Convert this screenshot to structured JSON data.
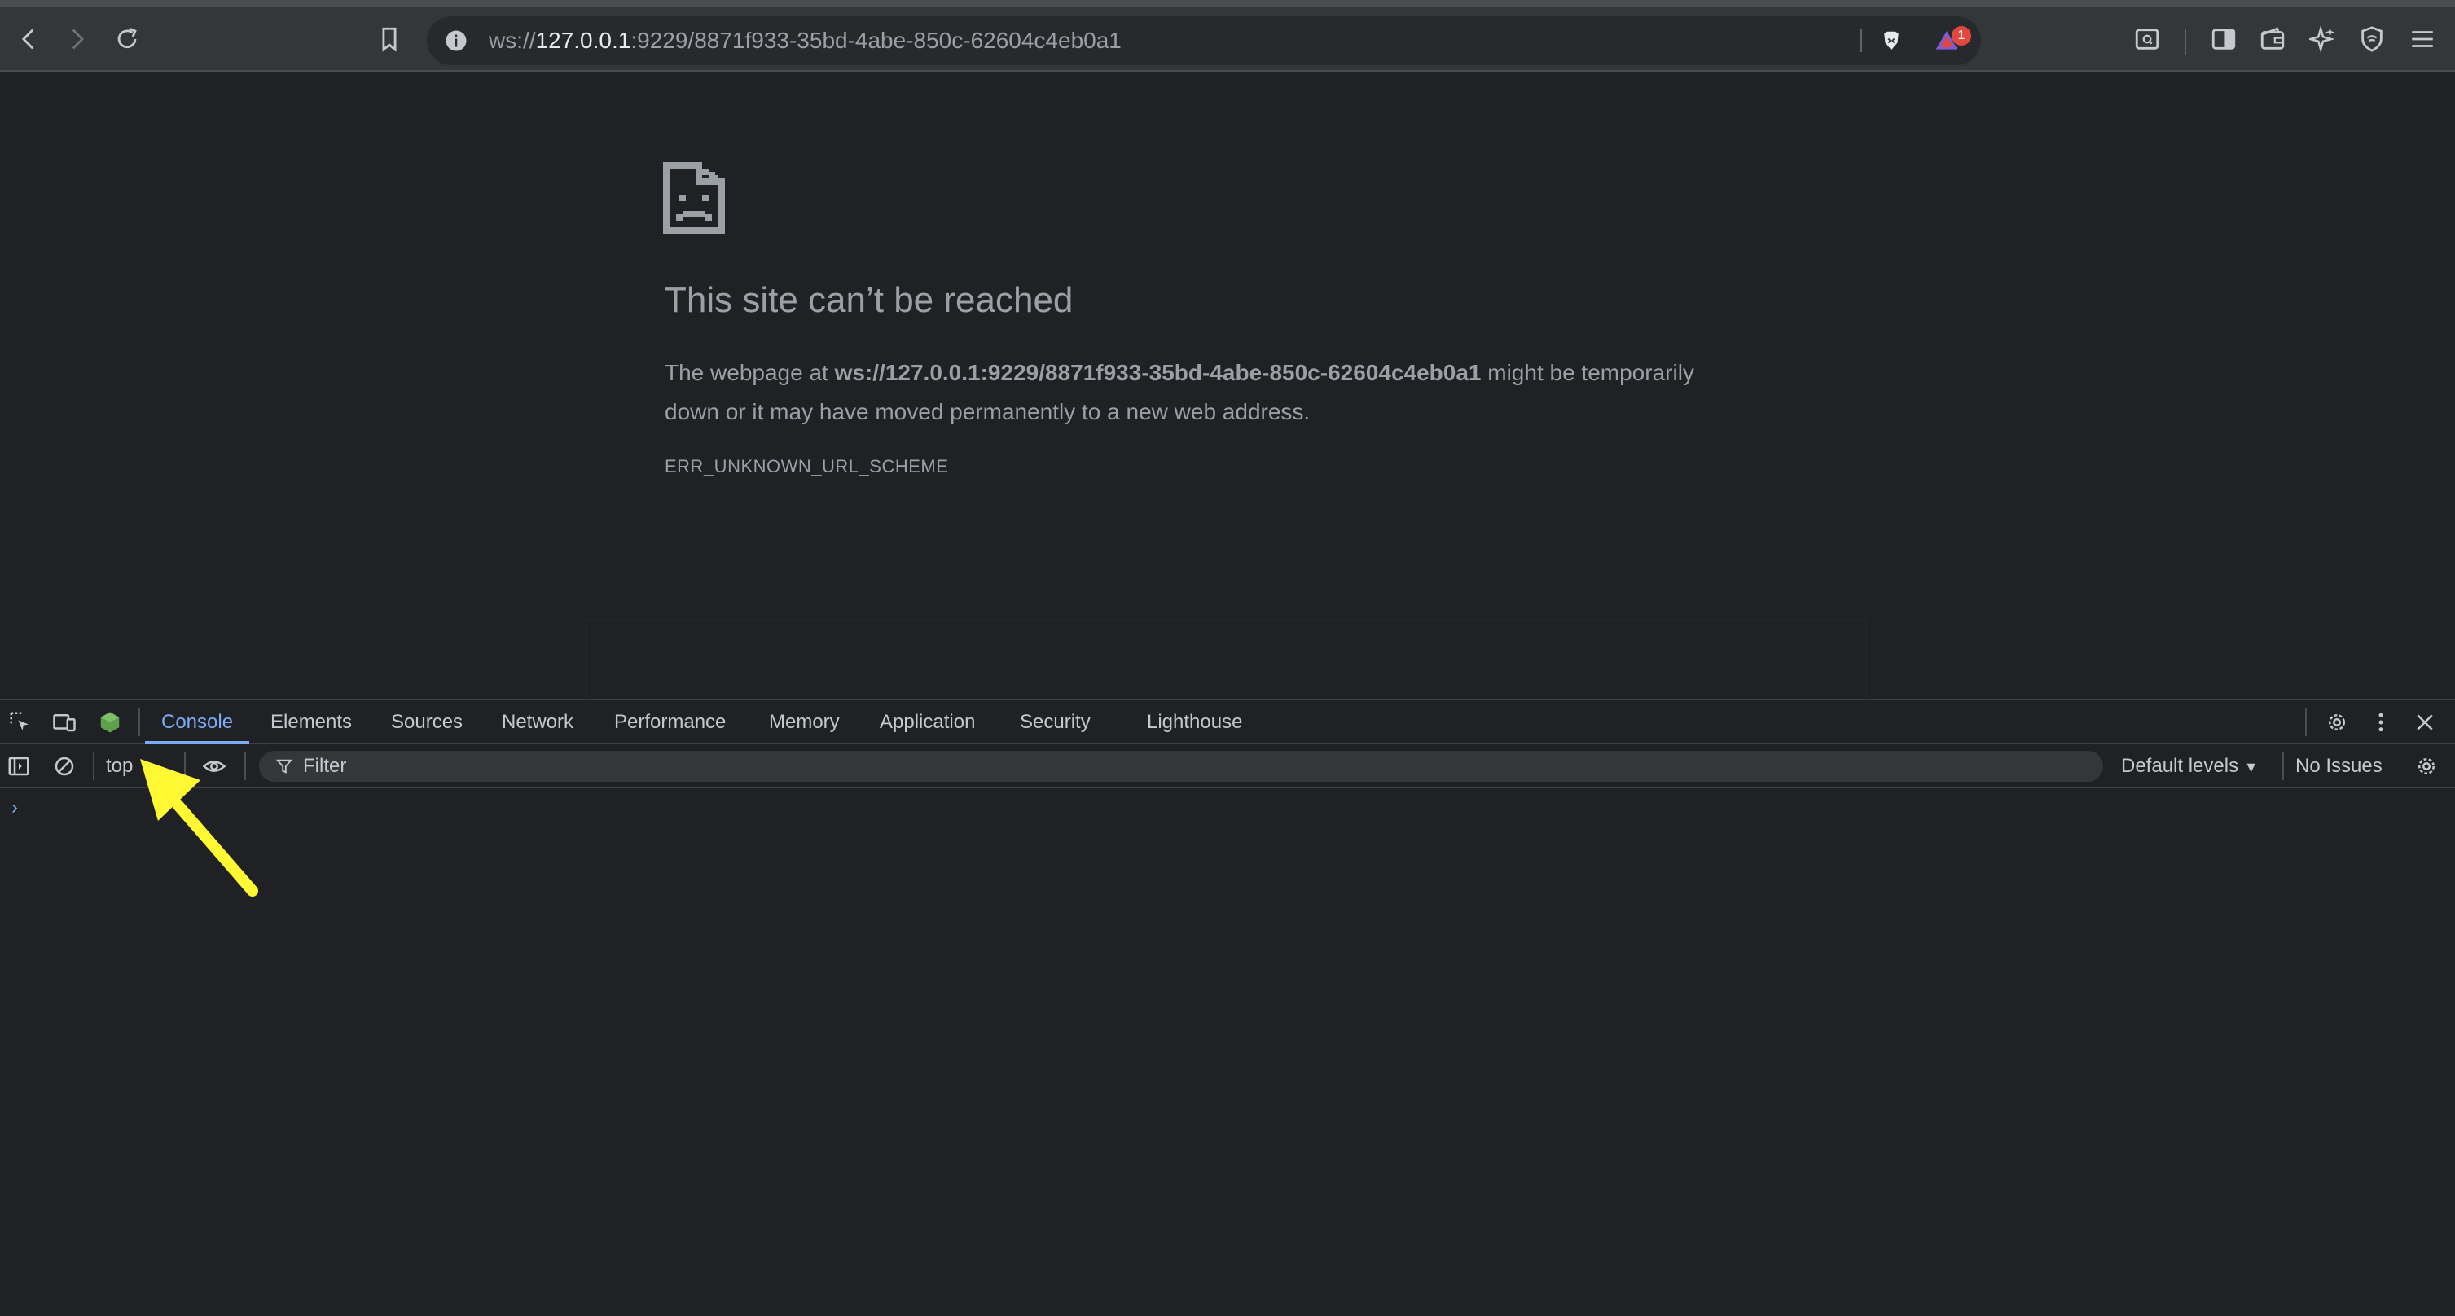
{
  "browser": {
    "url_prefix": "ws://",
    "url_host": "127.0.0.1",
    "url_rest": ":9229/8871f933-35bd-4abe-850c-62604c4eb0a1",
    "notification_count": "1",
    "colors": {
      "toolbar": "#35363a",
      "omnibox": "#28292c",
      "badge": "#e3483f"
    }
  },
  "error_page": {
    "title": "This site can’t be reached",
    "message_before": "The webpage at ",
    "message_url": "ws://127.0.0.1:9229/8871f933-35bd-4abe-850c-62604c4eb0a1",
    "message_after": " might be temporarily down or it may have moved permanently to a new web address.",
    "error_code": "ERR_UNKNOWN_URL_SCHEME"
  },
  "devtools": {
    "tabs": [
      {
        "label": "Console",
        "active": true
      },
      {
        "label": "Elements"
      },
      {
        "label": "Sources"
      },
      {
        "label": "Network"
      },
      {
        "label": "Performance"
      },
      {
        "label": "Memory"
      },
      {
        "label": "Application"
      },
      {
        "label": "Security"
      },
      {
        "label": "Lighthouse"
      }
    ],
    "console": {
      "context": "top",
      "filter_placeholder": "Filter",
      "levels_label": "Default levels",
      "issues_label": "No Issues",
      "prompt": "›"
    },
    "colors": {
      "accent": "#7cacf8",
      "node_icon": "#5fa04e"
    }
  },
  "annotation": {
    "arrow_color": "#fff833"
  }
}
